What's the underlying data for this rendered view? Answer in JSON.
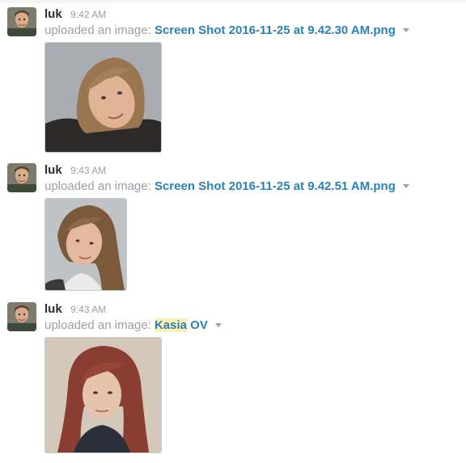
{
  "messages": [
    {
      "author": "luk",
      "time": "9:42 AM",
      "prefix": "uploaded an image:",
      "file": "Screen Shot 2016-11-25 at 9.42.30 AM.png",
      "file_highlight": "",
      "file_rest": ""
    },
    {
      "author": "luk",
      "time": "9:43 AM",
      "prefix": "uploaded an image:",
      "file": "Screen Shot 2016-11-25 at 9.42.51 AM.png",
      "file_highlight": "",
      "file_rest": ""
    },
    {
      "author": "luk",
      "time": "9:43 AM",
      "prefix": "uploaded an image:",
      "file": "",
      "file_highlight": "Kasia",
      "file_rest": " OV"
    }
  ],
  "icons": {
    "caret": "chevron-down-icon",
    "avatar": "user-avatar"
  },
  "colors": {
    "link": "#2a80b9",
    "muted": "#9e9ea6",
    "author": "#2c2d30",
    "highlight": "#fcefb0"
  }
}
